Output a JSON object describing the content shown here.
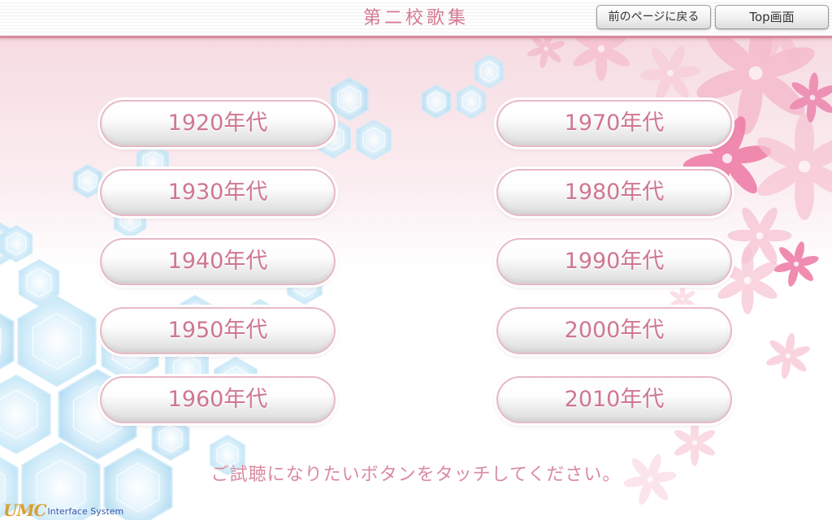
{
  "header": {
    "title": "第二校歌集",
    "back_label": "前のページに戻る",
    "top_label": "Top画面"
  },
  "decades": {
    "left": [
      "1920年代",
      "1930年代",
      "1940年代",
      "1950年代",
      "1960年代"
    ],
    "right": [
      "1970年代",
      "1980年代",
      "1990年代",
      "2000年代",
      "2010年代"
    ]
  },
  "instruction": "ご試聴になりたいボタンをタッチしてください。",
  "logo": {
    "mark": "UMC",
    "text": "Interface System"
  },
  "colors": {
    "accent_pink": "#d47a90",
    "flower_pink": "#f08fb3",
    "hexagon_blue": "#bfe3f5"
  }
}
